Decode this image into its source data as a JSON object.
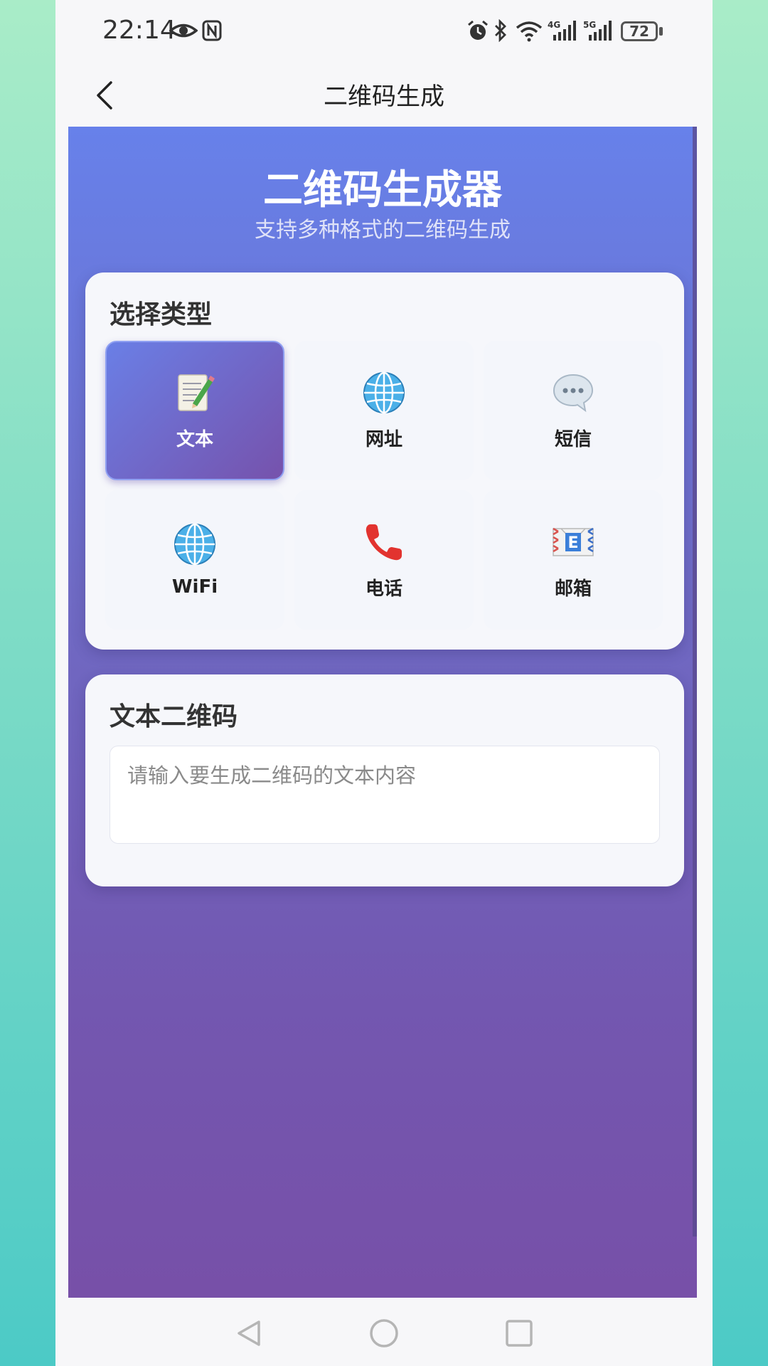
{
  "status_bar": {
    "time": "22:14",
    "battery": "72",
    "icons": [
      "eye-icon",
      "nfc-icon",
      "alarm-icon",
      "bluetooth-icon",
      "wifi-icon",
      "signal-4g-icon",
      "signal-5g-icon",
      "battery-icon"
    ]
  },
  "app_bar": {
    "title": "二维码生成"
  },
  "hero": {
    "title": "二维码生成器",
    "subtitle": "支持多种格式的二维码生成"
  },
  "type_card": {
    "title": "选择类型",
    "selected": "文本",
    "types": [
      {
        "label": "文本",
        "icon": "memo-icon"
      },
      {
        "label": "网址",
        "icon": "globe-icon"
      },
      {
        "label": "短信",
        "icon": "speech-bubble-icon"
      },
      {
        "label": "WiFi",
        "icon": "globe-icon"
      },
      {
        "label": "电话",
        "icon": "telephone-icon"
      },
      {
        "label": "邮箱",
        "icon": "envelope-icon"
      }
    ]
  },
  "input_card": {
    "title": "文本二维码",
    "placeholder": "请输入要生成二维码的文本内容",
    "value": ""
  },
  "colors": {
    "accent_start": "#6a7fe6",
    "accent_end": "#7652ac",
    "background_top": "#6781ea",
    "background_bottom": "#7750a8"
  }
}
